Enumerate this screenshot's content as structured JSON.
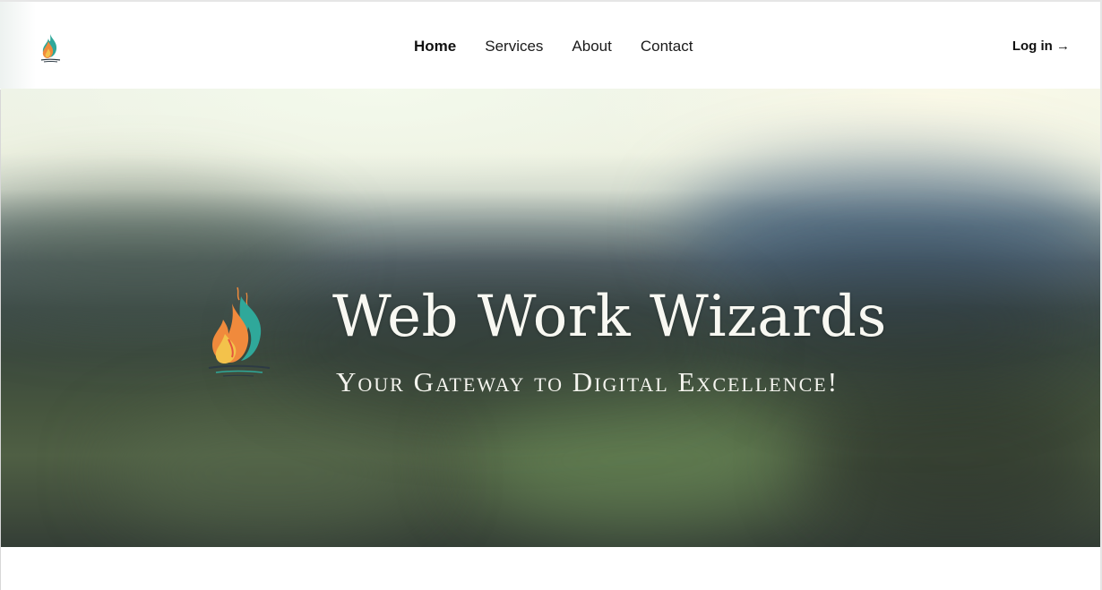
{
  "header": {
    "nav": [
      {
        "label": "Home",
        "active": true
      },
      {
        "label": "Services",
        "active": false
      },
      {
        "label": "About",
        "active": false
      },
      {
        "label": "Contact",
        "active": false
      }
    ],
    "login_label": "Log in →",
    "logo_icon": "flame-logo-icon"
  },
  "hero": {
    "title": "Web Work Wizards",
    "subtitle": "Your Gateway to Digital Excellence!",
    "logo_icon": "flame-logo-icon"
  },
  "colors": {
    "flame_orange": "#f08a3c",
    "flame_teal": "#2fa89a",
    "flame_yellow": "#f3c24b",
    "text_dark": "#111111",
    "hero_text": "#f8f8f2"
  }
}
